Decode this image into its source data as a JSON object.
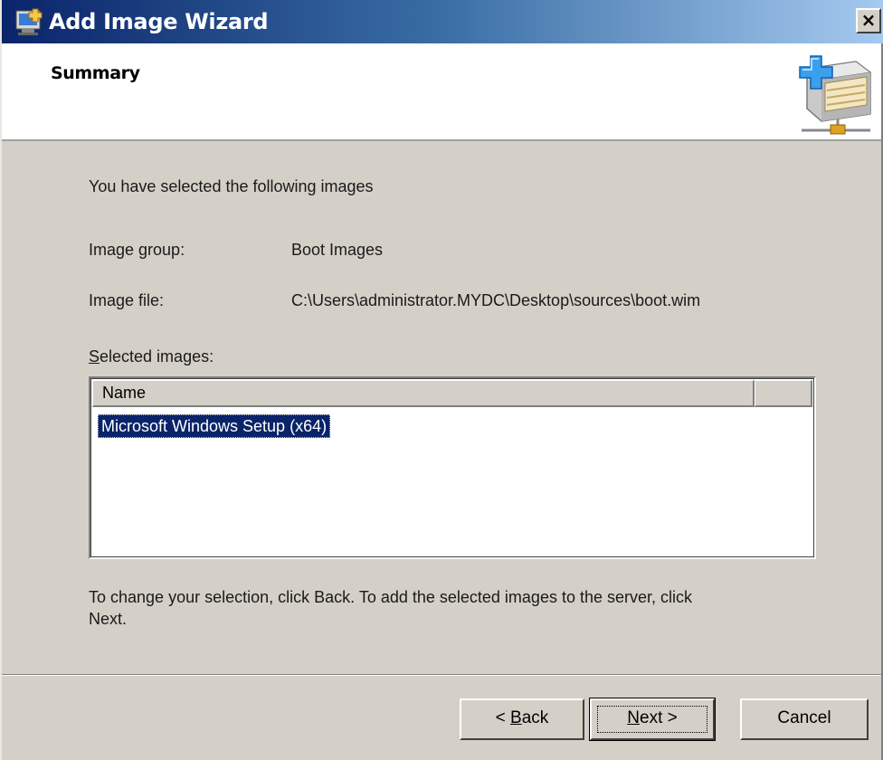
{
  "window": {
    "title": "Add Image Wizard",
    "close_label": "×"
  },
  "header": {
    "title": "Summary"
  },
  "body": {
    "intro": "You have selected the following images",
    "image_group_label": "Image group:",
    "image_group_value": "Boot Images",
    "image_file_label": "Image file:",
    "image_file_value": "C:\\Users\\administrator.MYDC\\Desktop\\sources\\boot.wim",
    "selected_images_label_first": "S",
    "selected_images_label_rest": "elected images:",
    "list": {
      "columns": [
        "Name",
        ""
      ],
      "rows": [
        "Microsoft Windows Setup (x64)"
      ]
    },
    "instructions_line1": "To change your selection, click Back. To add the selected images to the server, click",
    "instructions_line2": "Next."
  },
  "buttons": {
    "back_prefix": "< ",
    "back_mnemonic": "B",
    "back_rest": "ack",
    "next_mnemonic": "N",
    "next_rest": "ext >",
    "cancel": "Cancel"
  },
  "colors": {
    "titlebar_start": "#0a246a",
    "selection": "#0a246a",
    "dialog_face": "#d4d0c8"
  }
}
